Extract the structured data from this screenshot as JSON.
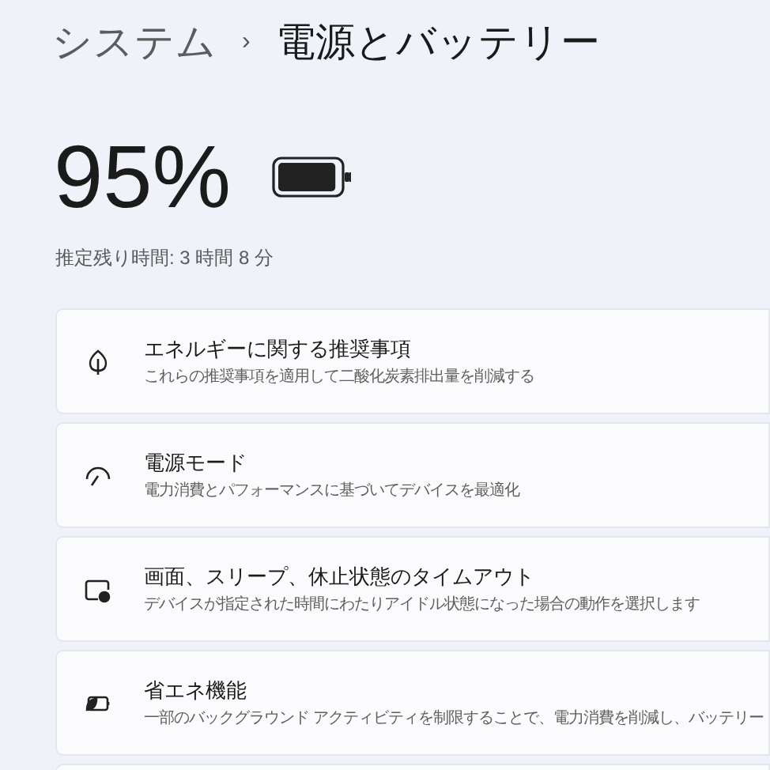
{
  "breadcrumb": {
    "parent": "システム",
    "separator": "›",
    "current": "電源とバッテリー"
  },
  "battery": {
    "percent": "95%",
    "level": 0.95,
    "estimate": "推定残り時間: 3 時間 8 分"
  },
  "settings": [
    {
      "kind": "leaf",
      "title": "エネルギーに関する推奨事項",
      "description": "これらの推奨事項を適用して二酸化炭素排出量を削減する"
    },
    {
      "kind": "gauge",
      "title": "電源モード",
      "description": "電力消費とパフォーマンスに基づいてデバイスを最適化"
    },
    {
      "kind": "sleep",
      "title": "画面、スリープ、休止状態のタイムアウト",
      "description": "デバイスが指定された時間にわたりアイドル状態になった場合の動作を選択します"
    },
    {
      "kind": "saver",
      "title": "省エネ機能",
      "description": "一部のバックグラウンド アクティビティを制限することで、電力消費を削減し、バッテリー"
    }
  ]
}
